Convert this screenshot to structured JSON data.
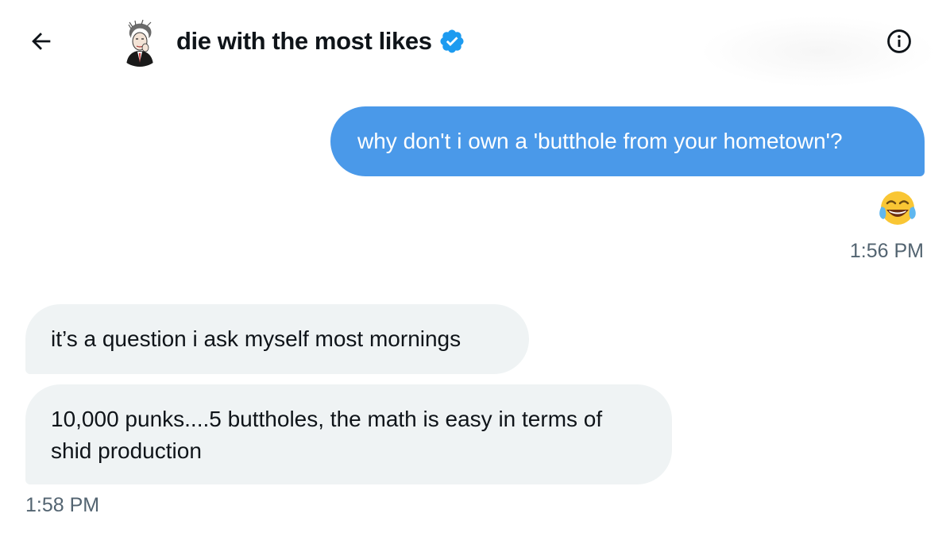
{
  "header": {
    "title": "die with the most likes",
    "back_icon": "arrow-left-icon",
    "verified_icon": "verified-badge-icon",
    "info_icon": "info-icon",
    "verified_color": "#1d9bf0"
  },
  "messages": [
    {
      "side": "sent",
      "text": "why don't i own a 'butthole from your hometown'?",
      "reaction": "😂",
      "time": "1:56 PM"
    },
    {
      "side": "received",
      "text": "it’s a question i ask myself most mornings"
    },
    {
      "side": "received",
      "text": "10,000 punks....5 buttholes, the math is easy in terms of shid production",
      "time": "1:58 PM"
    }
  ],
  "colors": {
    "sent_bubble": "#4a99e9",
    "received_bubble": "#eff3f4",
    "timestamp": "#536471"
  }
}
